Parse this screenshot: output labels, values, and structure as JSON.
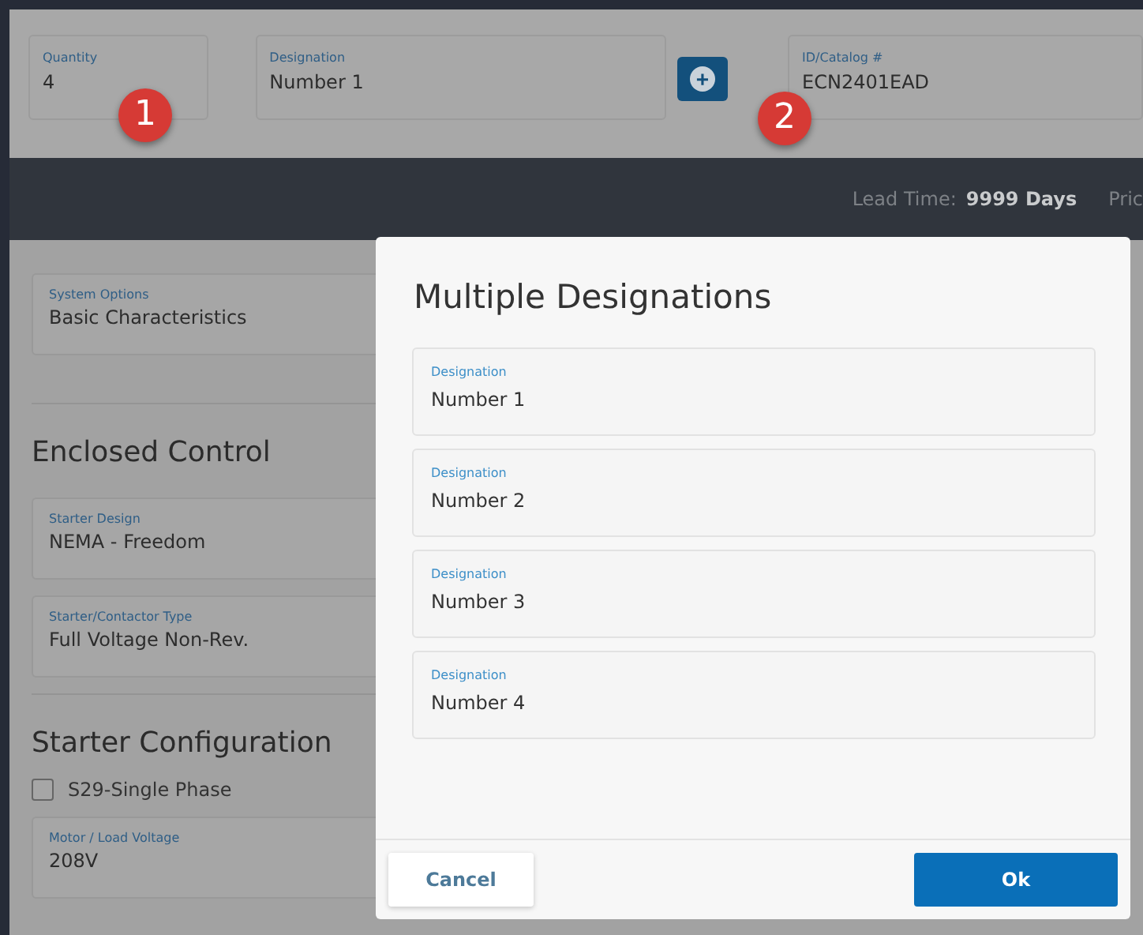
{
  "top_form": {
    "fields": [
      {
        "label": "Quantity",
        "value": "4"
      },
      {
        "label": "Designation",
        "value": "Number 1"
      },
      {
        "label": "ID/Catalog #",
        "value": "ECN2401EAD"
      }
    ],
    "add_button": "+",
    "callouts": [
      "1",
      "2"
    ]
  },
  "info_bar": {
    "lead_time_label": "Lead Time:",
    "lead_time_value": "9999 Days",
    "cut_label": "Pric"
  },
  "system_options": {
    "label": "System Options",
    "value": "Basic Characteristics"
  },
  "sections": [
    {
      "title": "Enclosed Control",
      "fields": [
        {
          "label": "Starter Design",
          "value": "NEMA - Freedom"
        },
        {
          "label": "Starter/Contactor Type",
          "value": "Full Voltage Non-Rev."
        }
      ]
    },
    {
      "title": "Starter Configuration",
      "checkbox": {
        "label": "S29-Single Phase",
        "checked": false
      },
      "fields": [
        {
          "label": "Motor / Load Voltage",
          "value": "208V"
        }
      ]
    }
  ],
  "dialog": {
    "title": "Multiple Designations",
    "fields": [
      {
        "label": "Designation",
        "value": "Number 1"
      },
      {
        "label": "Designation",
        "value": "Number 2"
      },
      {
        "label": "Designation",
        "value": "Number 3"
      },
      {
        "label": "Designation",
        "value": "Number 4"
      }
    ],
    "buttons": [
      {
        "label": "Cancel",
        "kind": "secondary"
      },
      {
        "label": "Ok",
        "kind": "primary"
      }
    ]
  }
}
